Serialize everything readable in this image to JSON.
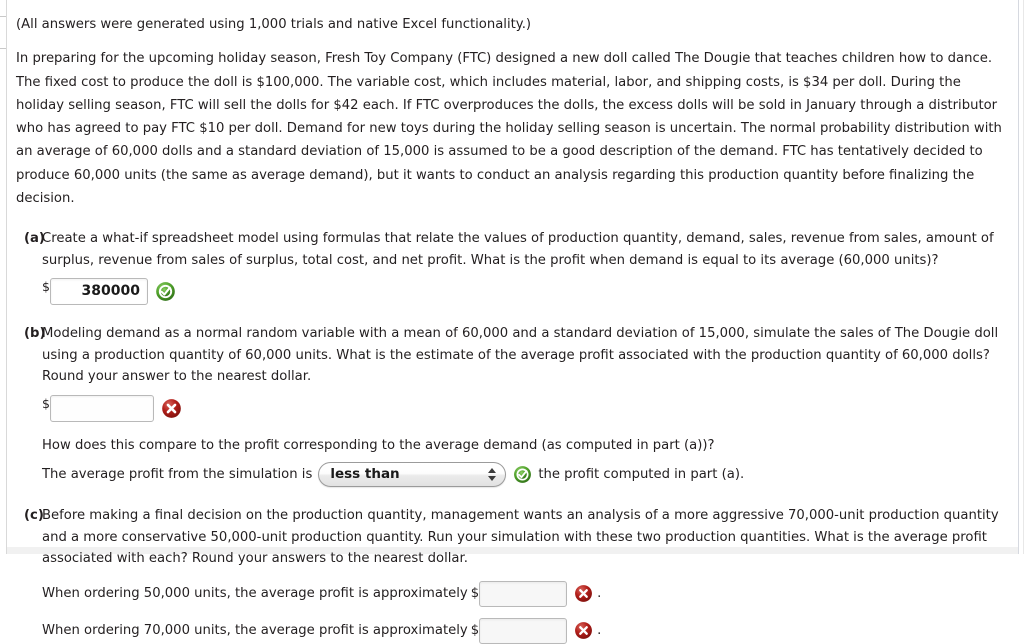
{
  "document": {
    "intro_note": "(All answers were generated using 1,000 trials and native Excel functionality.)",
    "scenario": "In preparing for the upcoming holiday season, Fresh Toy Company (FTC) designed a new doll called The Dougie that teaches children how to dance. The fixed cost to produce the doll is $100,000. The variable cost, which includes material, labor, and shipping costs, is $34 per doll. During the holiday selling season, FTC will sell the dolls for $42 each. If FTC overproduces the dolls, the excess dolls will be sold in January through a distributor who has agreed to pay FTC $10 per doll. Demand for new toys during the holiday selling season is uncertain. The normal probability distribution with an average of 60,000 dolls and a standard deviation of 15,000 is assumed to be a good description of the demand. FTC has tentatively decided to produce 60,000 units (the same as average demand), but it wants to conduct an analysis regarding this production quantity before finalizing the decision."
  },
  "parts": {
    "a": {
      "label": "(a)",
      "text": "Create a what-if spreadsheet model using formulas that relate the values of production quantity, demand, sales, revenue from sales, amount of surplus, revenue from sales of surplus, total cost, and net profit. What is the profit when demand is equal to its average (60,000 units)?",
      "dollar_sign": "$",
      "answer_value": "380000",
      "answer_placeholder": "",
      "status": "correct",
      "status_icon": "green-check-circle-icon"
    },
    "b": {
      "label": "(b)",
      "text": "Modeling demand as a normal random variable with a mean of 60,000 and a standard deviation of 15,000, simulate the sales of The Dougie doll using a production quantity of 60,000 units. What is the estimate of the average profit associated with the production quantity of 60,000 dolls? Round your answer to the nearest dollar.",
      "dollar_sign": "$",
      "answer_value": "",
      "answer_placeholder": "",
      "status": "incorrect",
      "status_icon": "red-x-circle-icon",
      "compare_question": "How does this compare to the profit corresponding to the average demand (as computed in part (a))?",
      "compare_prefix": "The average profit from the simulation is",
      "compare_selected": "less than",
      "compare_options": [
        "less than",
        "equal to",
        "greater than"
      ],
      "compare_suffix": "the profit computed in part (a).",
      "compare_status": "correct",
      "compare_status_icon": "green-check-circle-icon"
    },
    "c": {
      "label": "(c)",
      "text": "Before making a final decision on the production quantity, management wants an analysis of a more aggressive 70,000-unit production quantity and a more conservative 50,000-unit production quantity. Run your simulation with these two production quantities. What is the average profit associated with each? Round your answers to the nearest dollar.",
      "lines": [
        {
          "text": "When ordering 50,000 units, the average profit is approximately",
          "dollar_sign": "$",
          "answer_value": "",
          "answer_placeholder": "",
          "trailing_period": ".",
          "status": "incorrect",
          "status_icon": "red-x-circle-icon"
        },
        {
          "text": "When ordering 70,000 units, the average profit is approximately",
          "dollar_sign": "$",
          "answer_value": "",
          "answer_placeholder": "",
          "trailing_period": ".",
          "status": "incorrect",
          "status_icon": "red-x-circle-icon"
        }
      ]
    }
  },
  "colors": {
    "text": "#231f20",
    "correct_green": "#3a8a22",
    "incorrect_red": "#b01b17",
    "page_background": "#ffffff",
    "input_border": "#b9b9b9"
  }
}
